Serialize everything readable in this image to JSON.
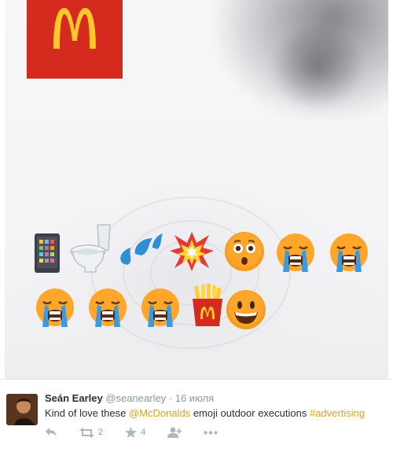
{
  "photo": {
    "description_label": "McDonald's emoji billboard photo",
    "brand_color": "#d52b1e",
    "logo_color": "#ffc72c"
  },
  "tweet": {
    "author_name": "Seán Earley",
    "author_handle": "@seanearley",
    "separator": "·",
    "date": "16 июля",
    "text_prefix": "Kind of love these ",
    "mention": "@McDonalds",
    "text_middle": " emoji outdoor executions ",
    "hashtag": "#advertising",
    "link_color": "#e0a31c",
    "actions": {
      "reply_icon": "reply-icon",
      "retweet_icon": "retweet-icon",
      "retweet_count": "2",
      "favorite_icon": "star-icon",
      "favorite_count": "4",
      "follow_icon": "follow-icon",
      "more_icon": "more-icon"
    }
  }
}
